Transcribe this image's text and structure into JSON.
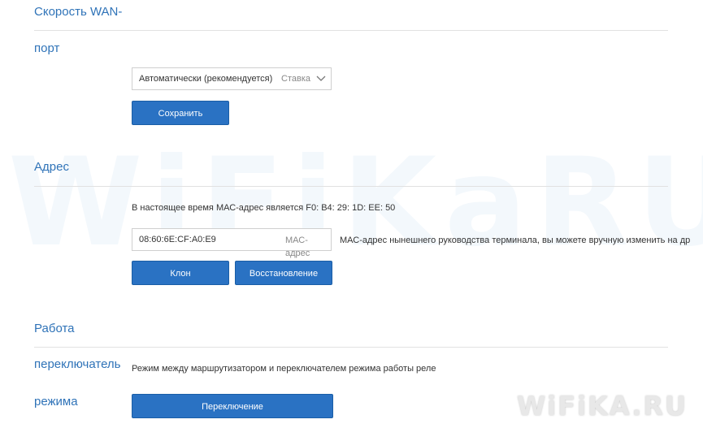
{
  "watermark": "WiFiKaRU",
  "wan_speed": {
    "title_line1": "Скорость WAN-",
    "title_line2": "порт",
    "select_value": "Автоматически (рекомендуется)",
    "select_tag": "Ставка",
    "save_label": "Сохранить"
  },
  "address": {
    "title": "Адрес",
    "current_mac_text": "В настоящее время МАС-адрес является F0: B4: 29: 1D: EE: 50",
    "mac_value": "08:60:6E:CF:A0:E9",
    "mac_suffix": "МАС-адрес",
    "mac_hint": "МАС-адрес нынешнего руководства терминала, вы можете вручную изменить на др",
    "clone_label": "Клон",
    "restore_label": "Восстановление"
  },
  "mode": {
    "title_line1": "Работа",
    "title_line2": "переключатель",
    "title_line3": "режима",
    "description": "Режим между маршрутизатором и переключателем режима работы реле",
    "switch_label": "Переключение"
  },
  "logo_text": "WiFiKA.RU",
  "colors": {
    "accent": "#2f73b8",
    "button": "#2a72c3"
  }
}
